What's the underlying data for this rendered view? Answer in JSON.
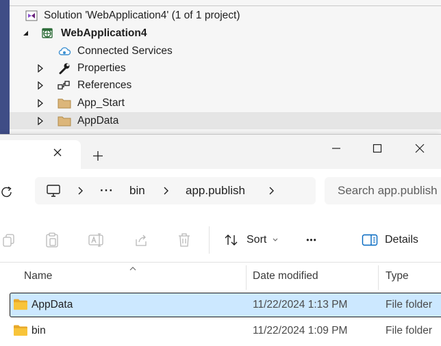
{
  "solution_explorer": {
    "items": [
      {
        "label": "Solution 'WebApplication4' (1 of 1 project)"
      },
      {
        "label": "WebApplication4"
      },
      {
        "label": "Connected Services"
      },
      {
        "label": "Properties"
      },
      {
        "label": "References"
      },
      {
        "label": "App_Start"
      },
      {
        "label": "AppData"
      }
    ]
  },
  "file_explorer": {
    "address": {
      "crumbs": [
        "bin",
        "app.publish"
      ],
      "overflow": "···",
      "search_placeholder": "Search app.publish"
    },
    "toolbar": {
      "sort_label": "Sort",
      "more_label": "•••",
      "details_label": "Details"
    },
    "columns": {
      "name": "Name",
      "date": "Date modified",
      "type": "Type"
    },
    "rows": [
      {
        "name": "AppData",
        "date": "11/22/2024 1:13 PM",
        "type": "File folder",
        "selected": true
      },
      {
        "name": "bin",
        "date": "11/22/2024 1:09 PM",
        "type": "File folder",
        "selected": false
      }
    ]
  },
  "colors": {
    "accent_blue": "#0067c0",
    "selection_fill": "#cce8ff",
    "vs_sidebar": "#3f4d86",
    "folder_yellow": "#f8c43a"
  }
}
